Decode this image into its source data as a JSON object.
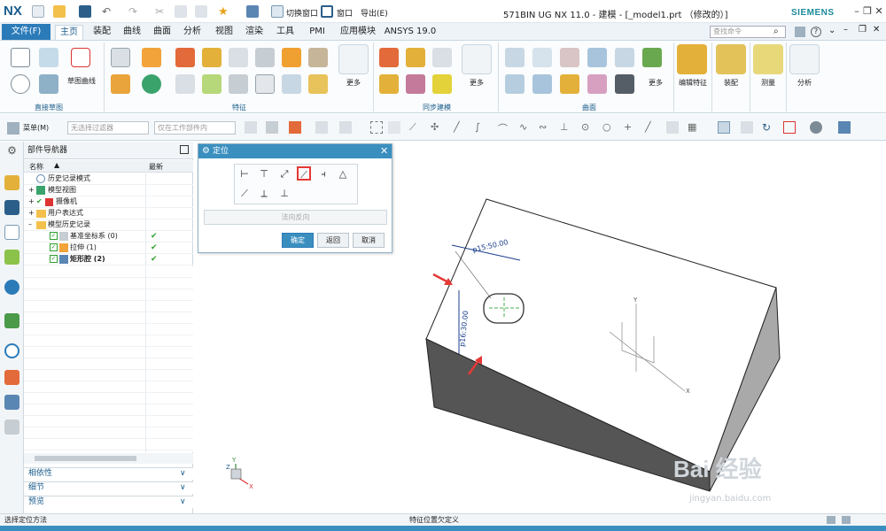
{
  "app": {
    "logo": "NX",
    "window_title": "571BIN UG NX 11.0 - 建模 - [_model1.prt （修改的）]",
    "brand": "SIEMENS"
  },
  "quick_access": {
    "switch_window": "切换窗口",
    "window": "窗口",
    "export": "导出(E)"
  },
  "tabs": [
    "文件(F)",
    "主页",
    "装配",
    "曲线",
    "曲面",
    "分析",
    "视图",
    "渲染",
    "工具",
    "PMI",
    "应用模块",
    "ANSYS 19.0"
  ],
  "active_tab": "主页",
  "search": {
    "placeholder": "查找命令"
  },
  "ribbon": {
    "sketch_curve_label": "草图曲线",
    "more_label": "更多",
    "group_labels": [
      "直接草图",
      "特征",
      "同步建模",
      "曲面"
    ],
    "big_buttons": [
      "编辑特征",
      "装配",
      "测量",
      "分析"
    ]
  },
  "toolbar2": {
    "menu_label": "菜单(M)",
    "filter_placeholder": "无选择过滤器",
    "scope_placeholder": "仅在工作部件内"
  },
  "navigator": {
    "title": "部件导航器",
    "col_name": "名称",
    "col_latest": "最新",
    "rows": [
      {
        "label": "历史记录模式",
        "indent": 1,
        "check": ""
      },
      {
        "label": "模型视图",
        "indent": 1,
        "check": ""
      },
      {
        "label": "摄像机",
        "indent": 1,
        "check": ""
      },
      {
        "label": "用户表达式",
        "indent": 1,
        "check": ""
      },
      {
        "label": "模型历史记录",
        "indent": 1,
        "check": ""
      },
      {
        "label": "基准坐标系 (0)",
        "indent": 2,
        "check": "✔"
      },
      {
        "label": "拉伸 (1)",
        "indent": 2,
        "check": "✔"
      },
      {
        "label": "矩形腔 (2)",
        "indent": 2,
        "check": "✔"
      }
    ],
    "panels": [
      "相依性",
      "细节",
      "预览"
    ]
  },
  "dialog": {
    "title": "定位",
    "reverse_label": "法向反向",
    "ok": "确定",
    "back": "返回",
    "cancel": "取消"
  },
  "model": {
    "dim1": "p15:50.00",
    "dim2": "p16:30.00",
    "axis_x": "X",
    "axis_y": "Y",
    "axis_z": "Z"
  },
  "status": {
    "left": "选择定位方法",
    "center": "特征位置欠定义"
  },
  "watermark": {
    "text": "Bai 经验",
    "url": "jingyan.baidu.com"
  },
  "colors": {
    "accent": "#3a8fbf",
    "file_button": "#2b7bb9",
    "check": "#2ea02e",
    "dimension": "#1b3f8c",
    "arrow": "#e53935"
  }
}
